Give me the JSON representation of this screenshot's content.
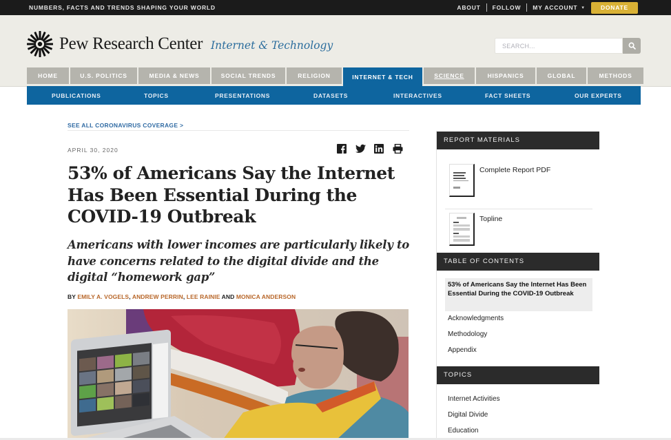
{
  "topbar": {
    "tagline": "NUMBERS, FACTS AND TRENDS SHAPING YOUR WORLD",
    "links": [
      "ABOUT",
      "FOLLOW",
      "MY ACCOUNT"
    ],
    "donate_label": "DONATE",
    "donate_color": "#d9b135"
  },
  "header": {
    "brand": "Pew Research Center",
    "section": "Internet & Technology",
    "search_placeholder": "SEARCH...",
    "search_icon": "search-icon"
  },
  "main_nav": {
    "tabs": [
      {
        "label": "HOME",
        "active": false
      },
      {
        "label": "U.S. POLITICS",
        "active": false
      },
      {
        "label": "MEDIA & NEWS",
        "active": false
      },
      {
        "label": "SOCIAL TRENDS",
        "active": false
      },
      {
        "label": "RELIGION",
        "active": false
      },
      {
        "label": "INTERNET & TECH",
        "active": true
      },
      {
        "label": "SCIENCE",
        "active": false
      },
      {
        "label": "HISPANICS",
        "active": false
      },
      {
        "label": "GLOBAL",
        "active": false
      },
      {
        "label": "METHODS",
        "active": false
      }
    ],
    "active_color": "#0e659f"
  },
  "sub_nav": {
    "items": [
      "PUBLICATIONS",
      "TOPICS",
      "PRESENTATIONS",
      "DATASETS",
      "INTERACTIVES",
      "FACT SHEETS",
      "OUR EXPERTS"
    ]
  },
  "article": {
    "coverage_link": "SEE ALL CORONAVIRUS COVERAGE >",
    "date": "APRIL 30, 2020",
    "share_icons": [
      "facebook-icon",
      "twitter-icon",
      "linkedin-icon",
      "print-icon"
    ],
    "title": "53% of Americans Say the Internet Has Been Essential During the COVID-19 Outbreak",
    "subtitle": "Americans with lower incomes are particularly likely to have concerns related to the digital divide and the digital “homework gap”",
    "byline_prefix": "BY",
    "authors": [
      "EMILY A. VOGELS",
      "ANDREW PERRIN",
      "LEE RAINIE",
      "MONICA ANDERSON"
    ],
    "byline_sep": ",",
    "byline_and": "AND",
    "author_color": "#b8672a",
    "photo_alt": "Woman reading a book to a video call on a laptop"
  },
  "sidebar": {
    "report_materials": {
      "heading": "REPORT MATERIALS",
      "items": [
        "Complete Report PDF",
        "Topline"
      ]
    },
    "toc": {
      "heading": "TABLE OF CONTENTS",
      "active": "53% of Americans Say the Internet Has Been Essential During the COVID-19 Outbreak",
      "items": [
        "Acknowledgments",
        "Methodology",
        "Appendix"
      ]
    },
    "topics": {
      "heading": "TOPICS",
      "items": [
        "Internet Activities",
        "Digital Divide",
        "Education"
      ]
    }
  }
}
